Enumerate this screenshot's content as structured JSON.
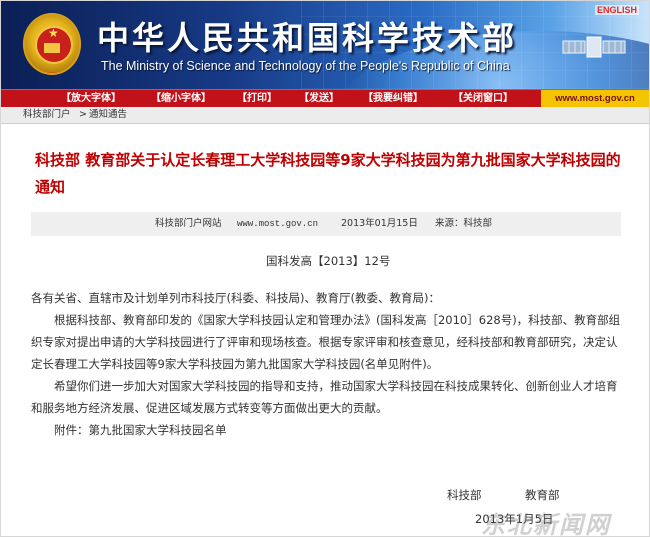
{
  "banner": {
    "title": "中华人民共和国科学技术部",
    "subtitle": "The Ministry of Science and Technology of the People's Republic of China",
    "english_link": "ENGLISH"
  },
  "toolbar": {
    "items": [
      "【放大字体】",
      "【缩小字体】",
      "【打印】",
      "【发送】",
      "【我要纠错】",
      "【关闭窗口】"
    ],
    "url": "www.most.gov.cn"
  },
  "breadcrumb": {
    "home": "科技部门户",
    "separator": ">",
    "current": "通知通告"
  },
  "article": {
    "title": "科技部 教育部关于认定长春理工大学科技园等9家大学科技园为第九批国家大学科技园的通知",
    "meta": {
      "source_site": "科技部门户网站",
      "site_url": "www.most.gov.cn",
      "date": "2013年01月15日",
      "source_label": "来源：科技部"
    },
    "doc_number": "国科发高【2013】12号",
    "salutation": "各有关省、直辖市及计划单列市科技厅(科委、科技局)、教育厅(教委、教育局)：",
    "paragraphs": [
      "根据科技部、教育部印发的《国家大学科技园认定和管理办法》(国科发高［2010］628号)，科技部、教育部组织专家对提出申请的大学科技园进行了评审和现场核查。根据专家评审和核查意见，经科技部和教育部研究，决定认定长春理工大学科技园等9家大学科技园为第九批国家大学科技园(名单见附件)。",
      "希望你们进一步加大对国家大学科技园的指导和支持，推动国家大学科技园在科技成果转化、创新创业人才培育和服务地方经济发展、促进区域发展方式转变等方面做出更大的贡献。",
      "附件：第九批国家大学科技园名单"
    ],
    "signatories": [
      "科技部",
      "教育部"
    ],
    "sign_date": "2013年1月5日"
  },
  "watermark": "东北新闻网"
}
